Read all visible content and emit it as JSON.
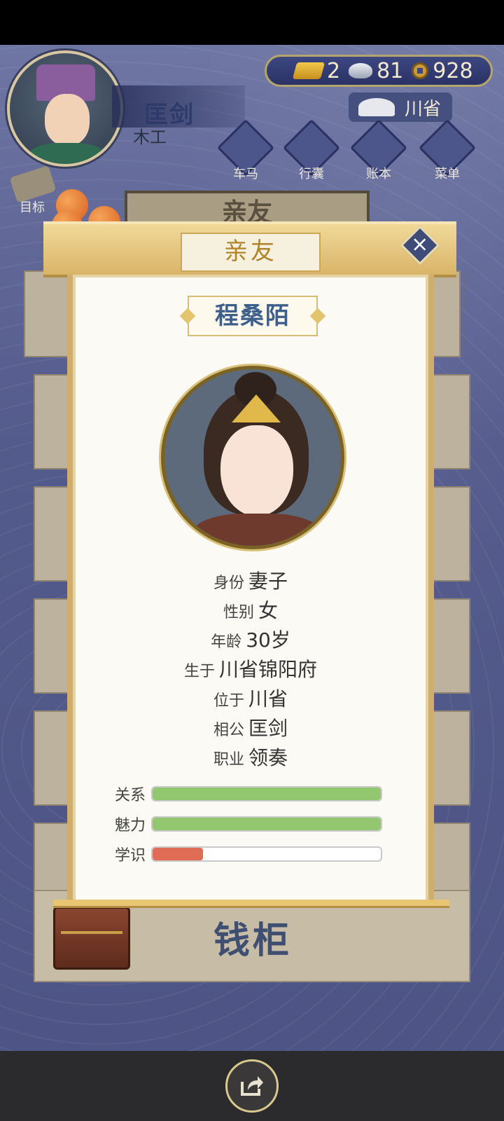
{
  "player": {
    "name": "匡剑",
    "job": "木工"
  },
  "currency": {
    "gold": "2",
    "silver": "81",
    "coins": "928"
  },
  "location": "川省",
  "nav": [
    {
      "label": "车马",
      "icon": "carriage-icon"
    },
    {
      "label": "行囊",
      "icon": "bag-icon"
    },
    {
      "label": "账本",
      "icon": "ledger-icon"
    },
    {
      "label": "菜单",
      "icon": "menu-icon"
    }
  ],
  "target_label": "目标",
  "background_title": "亲友",
  "money_cabinet_label": "钱柜",
  "modal": {
    "title": "亲友",
    "friend_name": "程桑陌",
    "info": [
      {
        "key": "身份",
        "value": "妻子"
      },
      {
        "key": "性别",
        "value": "女"
      },
      {
        "key": "年龄",
        "value": "30岁"
      },
      {
        "key": "生于",
        "value": "川省锦阳府"
      },
      {
        "key": "位于",
        "value": "川省"
      },
      {
        "key": "相公",
        "value": "匡剑"
      },
      {
        "key": "职业",
        "value": "领奏"
      }
    ],
    "stats": [
      {
        "key": "关系",
        "fraction": 1.0,
        "color": "#93c76f"
      },
      {
        "key": "魅力",
        "fraction": 1.0,
        "color": "#93c76f"
      },
      {
        "key": "学识",
        "fraction": 0.22,
        "color": "#e16c55"
      }
    ]
  }
}
